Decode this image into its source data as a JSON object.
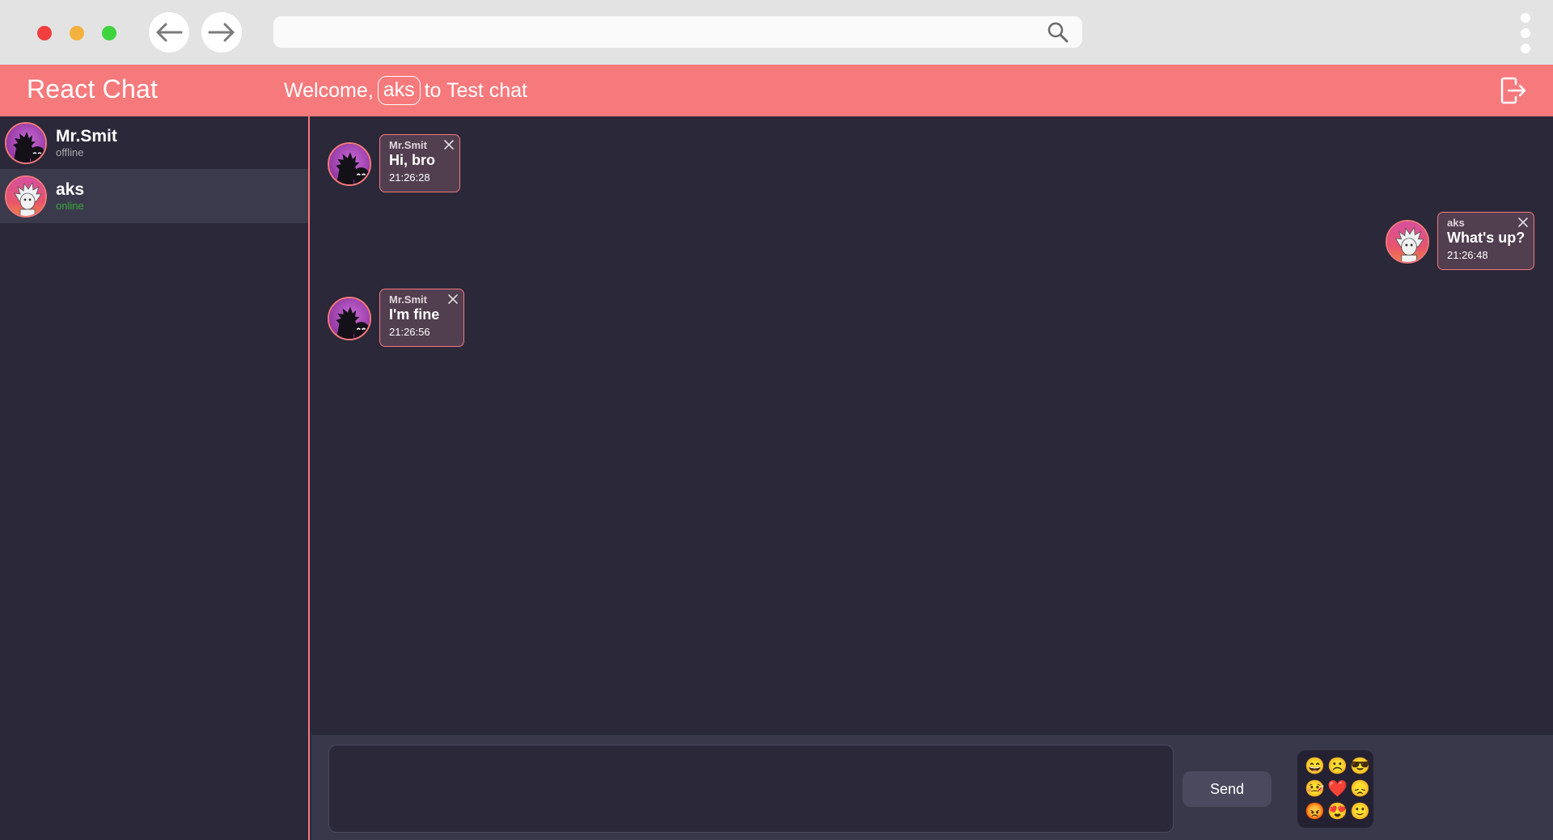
{
  "browser": {
    "url": "",
    "icons": {
      "back": "arrow-left-icon",
      "forward": "arrow-right-icon",
      "search": "search-icon",
      "menu": "kebab-menu-icon"
    }
  },
  "header": {
    "app_title": "React Chat",
    "welcome_prefix": "Welcome,",
    "username": "aks",
    "welcome_suffix": "to Test chat",
    "logout_icon": "logout-icon",
    "color": "#f6797c"
  },
  "sidebar": {
    "users": [
      {
        "name": "Mr.Smit",
        "status": "offline",
        "avatar": "morty-silhouette-avatar"
      },
      {
        "name": "aks",
        "status": "online",
        "avatar": "rick-avatar"
      }
    ]
  },
  "messages": [
    {
      "from": "Mr.Smit",
      "text": "Hi, bro",
      "time": "21:26:28",
      "side": "left"
    },
    {
      "from": "aks",
      "text": "What's up?",
      "time": "21:26:48",
      "side": "right"
    },
    {
      "from": "Mr.Smit",
      "text": "I'm fine",
      "time": "21:26:56",
      "side": "left"
    }
  ],
  "composer": {
    "input_value": "",
    "send_label": "Send",
    "emojis": [
      "😄",
      "☹️",
      "😎",
      "🤒",
      "❤️",
      "😞",
      "😡",
      "😍",
      "🙂"
    ]
  },
  "colors": {
    "accent": "#f6797c",
    "background": "#2a2839",
    "bubble": "#513e4f",
    "online": "#3aa63a"
  }
}
